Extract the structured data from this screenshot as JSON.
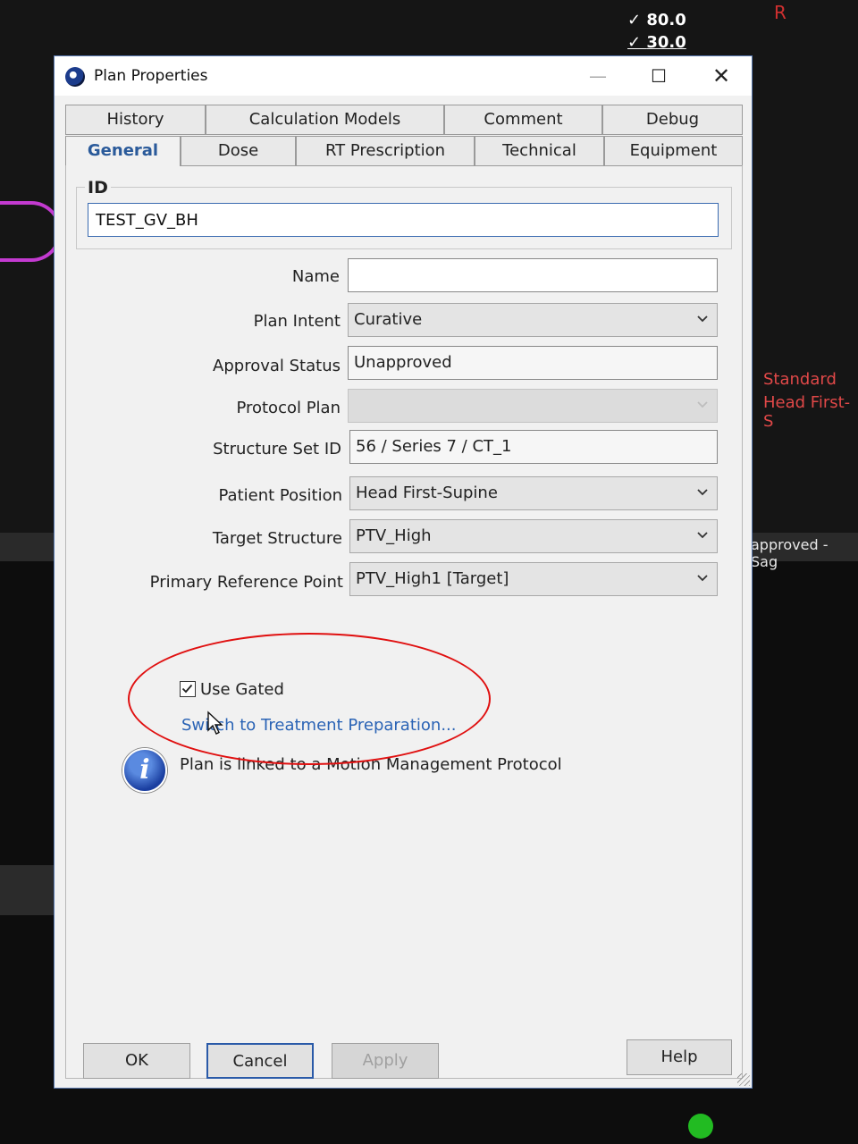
{
  "background": {
    "dose_top": "80.0",
    "dose_second": "30.0",
    "orientation_mark": "R",
    "orientation_line1": "Standard",
    "orientation_line2": "Head First-S",
    "status_strip_text": "approved - Sag",
    "accent_purple": "#c33ad0",
    "overlay_red": "#e04848"
  },
  "dialog": {
    "title": "Plan Properties",
    "window_controls": {
      "minimize": "—",
      "maximize": "☐",
      "close": "✕"
    },
    "tabs_row1": [
      "History",
      "Calculation Models",
      "Comment",
      "Debug"
    ],
    "tabs_row2": [
      "General",
      "Dose",
      "RT Prescription",
      "Technical",
      "Equipment"
    ],
    "active_tab": "General",
    "id_group": {
      "label": "ID",
      "value": "TEST_GV_BH"
    },
    "fields": {
      "name": {
        "label": "Name",
        "value": ""
      },
      "plan_intent": {
        "label": "Plan Intent",
        "value": "Curative"
      },
      "approval_status": {
        "label": "Approval Status",
        "value": "Unapproved"
      },
      "protocol_plan": {
        "label": "Protocol Plan",
        "value": ""
      },
      "structure_set_id": {
        "label": "Structure Set ID",
        "value": "56 / Series 7 / CT_1"
      },
      "patient_position": {
        "label": "Patient Position",
        "value": "Head First-Supine"
      },
      "target_structure": {
        "label": "Target Structure",
        "value": "PTV_High"
      },
      "primary_reference_point": {
        "label": "Primary Reference Point",
        "value": "PTV_High1 [Target]"
      }
    },
    "use_gated": {
      "label": "Use Gated",
      "checked": true
    },
    "switch_link": "Switch to Treatment Preparation...",
    "info_message": "Plan is linked to a Motion Management Protocol",
    "buttons": {
      "ok": "OK",
      "cancel": "Cancel",
      "apply": "Apply",
      "help": "Help"
    },
    "link_color": "#2a63b5",
    "active_tab_color": "#2a5a9a",
    "annotation_color": "#e01010"
  }
}
